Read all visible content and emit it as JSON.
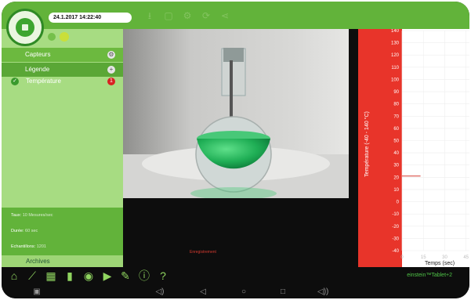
{
  "datetime": "24.1.2017 14:22:40",
  "sidebar": {
    "capteurs_label": "Capteurs",
    "legende_label": "Légende",
    "sensor": {
      "label": "Température",
      "badge": "1"
    },
    "info": [
      {
        "key": "Taux:",
        "value": "10 Mesures/sec"
      },
      {
        "key": "Durée:",
        "value": "60 sec"
      },
      {
        "key": "Echantillons:",
        "value": "1201"
      }
    ],
    "archives_label": "Archives"
  },
  "video": {
    "status": "Enregistrement"
  },
  "brand": "einstein™Tablet+2",
  "colors": {
    "accent_green": "#62b33a",
    "sidebar_green": "#a7dc82",
    "axis_red": "#e8342a",
    "series_red": "#d63a30"
  },
  "toolbar_icons": [
    "home-icon",
    "graph-icon",
    "table-icon",
    "bar-chart-icon",
    "compass-icon",
    "video-camera-icon",
    "pen-icon",
    "info-icon",
    "help-icon"
  ],
  "topbar_icons": [
    "download-icon",
    "save-icon",
    "settings-icon",
    "refresh-icon",
    "share-icon"
  ],
  "navbar_icons": [
    "screenshot-icon",
    "volume-down-icon",
    "back-icon",
    "home-nav-icon",
    "recents-icon",
    "volume-up-icon"
  ],
  "chart_data": {
    "type": "line",
    "ylabel": "Température (-40 - 140 °C)",
    "xlabel": "Temps (sec)",
    "yticks": [
      140,
      130,
      120,
      110,
      100,
      90,
      80,
      70,
      60,
      50,
      40,
      30,
      20,
      10,
      0,
      -10,
      -20,
      -30,
      -40
    ],
    "xticks": [
      0,
      15.0,
      30.0,
      45
    ],
    "ylim": [
      -40,
      140
    ],
    "xlim": [
      0,
      45
    ],
    "series": [
      {
        "x": [
          0,
          1,
          2,
          3,
          4,
          5,
          6,
          7,
          8,
          9,
          10,
          11,
          12,
          13
        ],
        "y": [
          21,
          21,
          21,
          21,
          21,
          21,
          21,
          21,
          21,
          21,
          21,
          21,
          21,
          21
        ]
      }
    ],
    "grid": true
  }
}
